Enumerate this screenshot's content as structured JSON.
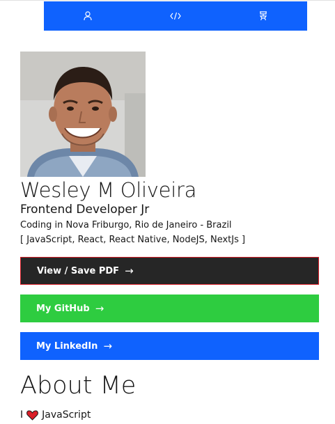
{
  "nav": {
    "items": [
      {
        "icon": "user-icon"
      },
      {
        "icon": "code-icon"
      },
      {
        "icon": "education-icon"
      }
    ]
  },
  "profile": {
    "name": "Wesley M Oliveira",
    "role": "Frontend Developer Jr",
    "location": "Coding in Nova Friburgo, Rio de Janeiro - Brazil",
    "skills": "[ JavaScript, React, React Native, NodeJS, NextJs ]"
  },
  "buttons": {
    "pdf": "View / Save PDF",
    "github": "My GitHub",
    "linkedin": "My LinkedIn",
    "arrow": "→"
  },
  "about": {
    "title": "About Me",
    "love_prefix": "I",
    "love_icon": "heart-icon",
    "love_subject": "JavaScript"
  },
  "colors": {
    "nav_bg": "#0f62fe",
    "pdf_bg": "#262626",
    "pdf_border": "#da1e28",
    "github_bg": "#2ecc40",
    "linkedin_bg": "#0f62fe",
    "heart": "#da1e28"
  }
}
